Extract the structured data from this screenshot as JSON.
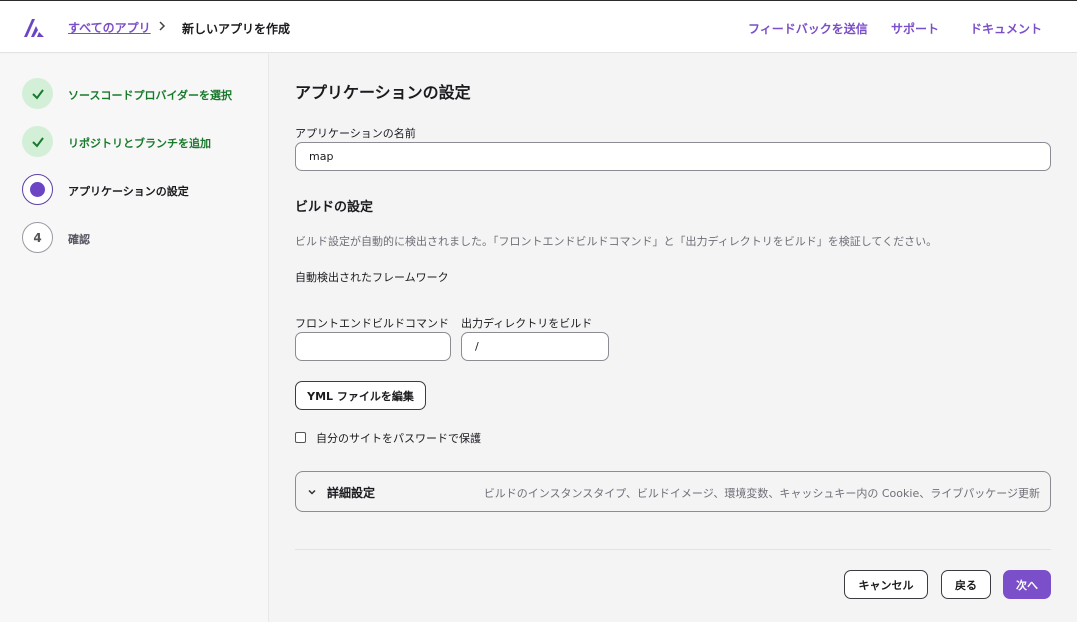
{
  "header": {
    "logo_icon": "amplify-logo-icon",
    "breadcrumb_link": "すべてのアプリ",
    "breadcrumb_current": "新しいアプリを作成",
    "nav": [
      "フィードバックを送信",
      "サポート",
      "ドキュメント"
    ]
  },
  "steps": [
    {
      "label": "ソースコードプロバイダーを選択",
      "state": "done",
      "icon": "check-icon"
    },
    {
      "label": "リポジトリとブランチを追加",
      "state": "done",
      "icon": "check-icon"
    },
    {
      "label": "アプリケーションの設定",
      "state": "current"
    },
    {
      "label": "確認",
      "state": "todo",
      "number": "4"
    }
  ],
  "main": {
    "title": "アプリケーションの設定",
    "app_name_label": "アプリケーションの名前",
    "app_name_value": "map",
    "build_title": "ビルドの設定",
    "build_desc": "ビルド設定が自動的に検出されました。「フロントエンドビルドコマンド」と「出力ディレクトリをビルド」を検証してください。",
    "framework_label": "自動検出されたフレームワーク",
    "frontend_cmd_label": "フロントエンドビルドコマンド",
    "frontend_cmd_value": "",
    "output_dir_label": "出力ディレクトリをビルド",
    "output_dir_value": "/",
    "edit_yml_button": "YML ファイルを編集",
    "password_checkbox_label": "自分のサイトをパスワードで保護",
    "password_checked": false,
    "advanced_title": "詳細設定",
    "advanced_desc": "ビルドのインスタンスタイプ、ビルドイメージ、環境変数、キャッシュキー内の Cookie、ライブパッケージ更新"
  },
  "footer": {
    "cancel": "キャンセル",
    "back": "戻る",
    "next": "次へ"
  },
  "colors": {
    "accent": "#7b4fc9",
    "success": "#1a7a2c",
    "success_bg": "#d3efd8"
  }
}
